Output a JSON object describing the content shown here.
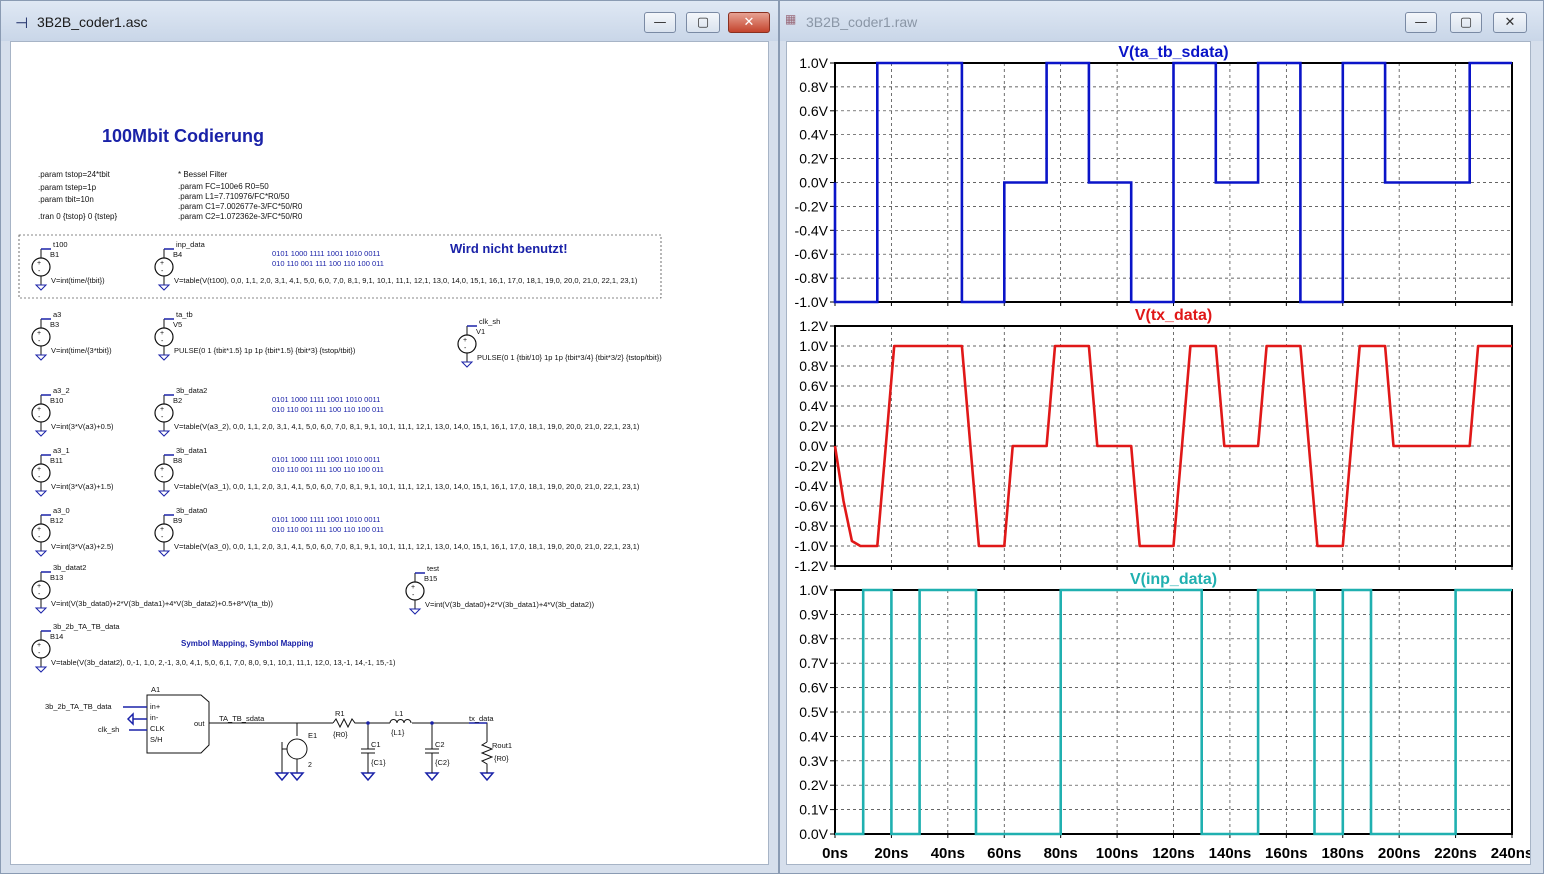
{
  "schematic_window": {
    "title": "3B2B_coder1.asc",
    "heading": "100Mbit Codierung",
    "params": [
      ".param tstop=24*tbit",
      ".param tstep=1p",
      ".param tbit=10n",
      ".tran 0 {tstop} 0 {tstep}"
    ],
    "bessel": [
      "* Bessel Filter",
      ".param FC=100e6 R0=50",
      ".param L1=7.710976/FC*R0/50",
      ".param C1=7.002677e-3/FC*50/R0",
      ".param C2=1.072362e-3/FC*50/R0"
    ],
    "unused_note": "Wird nicht benutzt!",
    "mapping_note": "Symbol Mapping, Symbol Mapping",
    "sources": [
      {
        "name": "B1",
        "net": "t100",
        "expr": "V=int(time/{tbit})"
      },
      {
        "name": "B4",
        "net": "inp_data",
        "expr": "V=table(V(t100), 0,0, 1,1, 2,0, 3,1, 4,1, 5,0,  6,0, 7,0, 8,1, 9,1, 10,1, 11,1, 12,1, 13,0, 14,0, 15,1, 16,1, 17,0, 18,1, 19,0, 20,0, 21,0, 22,1, 23,1)",
        "bits1": "0101 1000 1111 1001 1010 0011",
        "bits2": "010 110 001 111 100 110 100 011"
      },
      {
        "name": "B3",
        "net": "a3",
        "expr": "V=int(time/{3*tbit})"
      },
      {
        "name": "V5",
        "net": "ta_tb",
        "expr": "PULSE(0 1  {tbit*1.5} 1p 1p {tbit*1.5} {tbit*3} {tstop/tbit})"
      },
      {
        "name": "V1",
        "net": "clk_sh",
        "expr": "PULSE(0 1 {tbit/10} 1p 1p {tbit*3/4} {tbit*3/2} {tstop/tbit})"
      },
      {
        "name": "B10",
        "net": "a3_2",
        "expr": "V=int(3*V(a3)+0.5)"
      },
      {
        "name": "B2",
        "net": "3b_data2",
        "expr": "V=table(V(a3_2), 0,0, 1,1, 2,0, 3,1, 4,1, 5,0,  6,0, 7,0, 8,1, 9,1, 10,1, 11,1, 12,1, 13,0, 14,0, 15,1, 16,1, 17,0, 18,1, 19,0, 20,0, 21,0, 22,1, 23,1)",
        "bits1": "0101 1000 1111 1001 1010 0011",
        "bits2": "010 110 001 111 100 110 100 011"
      },
      {
        "name": "B11",
        "net": "a3_1",
        "expr": "V=int(3*V(a3)+1.5)"
      },
      {
        "name": "B8",
        "net": "3b_data1",
        "expr": "V=table(V(a3_1), 0,0, 1,1, 2,0, 3,1, 4,1, 5,0,  6,0, 7,0, 8,1, 9,1, 10,1, 11,1, 12,1, 13,0, 14,0, 15,1, 16,1, 17,0, 18,1, 19,0, 20,0, 21,0, 22,1, 23,1)",
        "bits1": "0101 1000 1111 1001 1010 0011",
        "bits2": "010 110 001 111 100 110 100 011"
      },
      {
        "name": "B12",
        "net": "a3_0",
        "expr": "V=int(3*V(a3)+2.5)"
      },
      {
        "name": "B9",
        "net": "3b_data0",
        "expr": "V=table(V(a3_0), 0,0, 1,1, 2,0, 3,1, 4,1, 5,0,  6,0, 7,0, 8,1, 9,1, 10,1, 11,1, 12,1, 13,0, 14,0, 15,1, 16,1, 17,0, 18,1, 19,0, 20,0, 21,0, 22,1, 23,1)",
        "bits1": "0101 1000 1111 1001 1010 0011",
        "bits2": "010 110 001 111 100 110 100 011"
      },
      {
        "name": "B13",
        "net": "3b_datat2",
        "expr": "V=int(V(3b_data0)+2*V(3b_data1)+4*V(3b_data2)+0.5+8*V(ta_tb))"
      },
      {
        "name": "B15",
        "net": "test",
        "expr": "V=int(V(3b_data0)+2*V(3b_data1)+4*V(3b_data2))"
      },
      {
        "name": "B14",
        "net": "3b_2b_TA_TB_data",
        "expr": "V=table(V(3b_datat2), 0,-1, 1,0, 2,-1, 3,0, 4,1, 5,0,  6,1, 7,0,  8,0, 9,1, 10,1, 11,1, 12,0, 13,-1,  14,-1, 15,-1)"
      }
    ],
    "circuit": {
      "a1": "A1",
      "in_net": "3b_2b_TA_TB_data",
      "clk_net": "clk_sh",
      "pins": [
        "in+",
        "in-",
        "CLK",
        "S/H"
      ],
      "out_pin": "out",
      "out_net": "TA_TB_sdata",
      "e1": "E1",
      "e1_pin": "2",
      "r1": "R1",
      "r1_val": "{R0}",
      "l1": "L1",
      "l1_val": "{L1}",
      "c1": "C1",
      "c1_val": "{C1}",
      "c2": "C2",
      "c2_val": "{C2}",
      "rout": "Rout1",
      "rout_val": "{R0}",
      "tx_net": "tx_data"
    }
  },
  "waveform_window": {
    "title": "3B2B_coder1.raw",
    "x_ticks": [
      "0ns",
      "20ns",
      "40ns",
      "60ns",
      "80ns",
      "100ns",
      "120ns",
      "140ns",
      "160ns",
      "180ns",
      "200ns",
      "220ns",
      "240ns"
    ]
  },
  "chart_data": [
    {
      "type": "line",
      "title": "V(ta_tb_sdata)",
      "color": "#0a14c8",
      "xlim": [
        0,
        240
      ],
      "ylim": [
        -1,
        1
      ],
      "y_ticks": [
        "1.0V",
        "0.8V",
        "0.6V",
        "0.4V",
        "0.2V",
        "0.0V",
        "-0.2V",
        "-0.4V",
        "-0.6V",
        "-0.8V",
        "-1.0V"
      ],
      "series": [
        {
          "x": [
            0,
            0,
            15,
            15,
            45,
            45,
            60,
            60,
            75,
            75,
            90,
            90,
            105,
            105,
            120,
            120,
            135,
            135,
            150,
            150,
            165,
            165,
            180,
            180,
            195,
            195,
            225,
            225,
            240
          ],
          "y": [
            0,
            -1,
            -1,
            1,
            1,
            -1,
            -1,
            0,
            0,
            1,
            1,
            0,
            0,
            -1,
            -1,
            1,
            1,
            0,
            0,
            1,
            1,
            -1,
            -1,
            1,
            1,
            0,
            0,
            1,
            1
          ]
        }
      ]
    },
    {
      "type": "line",
      "title": "V(tx_data)",
      "color": "#e01818",
      "xlim": [
        0,
        240
      ],
      "ylim": [
        -1.2,
        1.2
      ],
      "y_ticks": [
        "1.2V",
        "1.0V",
        "0.8V",
        "0.6V",
        "0.4V",
        "0.2V",
        "0.0V",
        "-0.2V",
        "-0.4V",
        "-0.6V",
        "-0.8V",
        "-1.0V",
        "-1.2V"
      ],
      "series": [
        {
          "x": [
            0,
            3,
            6,
            9,
            15,
            18,
            21,
            45,
            48,
            51,
            54,
            60,
            63,
            66,
            75,
            78,
            81,
            90,
            93,
            96,
            105,
            108,
            111,
            120,
            123,
            126,
            135,
            138,
            141,
            150,
            153,
            156,
            165,
            168,
            171,
            180,
            183,
            186,
            195,
            198,
            201,
            225,
            228,
            231,
            240
          ],
          "y": [
            0,
            -0.55,
            -0.95,
            -1,
            -1,
            0,
            1,
            1,
            0,
            -1,
            -1,
            -1,
            0,
            0,
            0,
            1,
            1,
            1,
            0,
            0,
            0,
            -1,
            -1,
            -1,
            0,
            1,
            1,
            0,
            0,
            0,
            1,
            1,
            1,
            0,
            -1,
            -1,
            0,
            1,
            1,
            0,
            0,
            0,
            1,
            1,
            1
          ]
        }
      ]
    },
    {
      "type": "line",
      "title": "V(inp_data)",
      "color": "#20b0b0",
      "xlim": [
        0,
        240
      ],
      "ylim": [
        0,
        1
      ],
      "y_ticks": [
        "1.0V",
        "0.9V",
        "0.8V",
        "0.7V",
        "0.6V",
        "0.5V",
        "0.4V",
        "0.3V",
        "0.2V",
        "0.1V",
        "0.0V"
      ],
      "series": [
        {
          "x": [
            0,
            10,
            10,
            20,
            20,
            30,
            30,
            50,
            50,
            80,
            80,
            130,
            130,
            150,
            150,
            170,
            170,
            180,
            180,
            190,
            190,
            220,
            220,
            240
          ],
          "y": [
            0,
            0,
            1,
            1,
            0,
            0,
            1,
            1,
            0,
            0,
            1,
            1,
            0,
            0,
            1,
            1,
            0,
            0,
            1,
            1,
            0,
            0,
            1,
            1
          ]
        }
      ]
    }
  ]
}
